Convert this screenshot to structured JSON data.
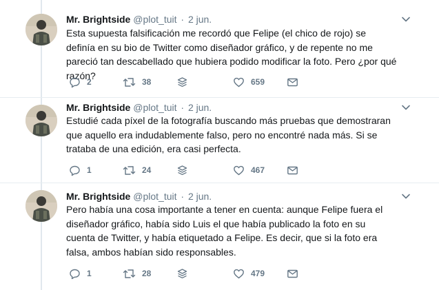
{
  "tweets": [
    {
      "author": "Mr. Brightside",
      "handle": "@plot_tuit",
      "separator": "·",
      "date": "2 jun.",
      "text": "Esta supuesta falsificación me recordó que Felipe (el chico de rojo) se definía en su bio de Twitter como diseñador gráfico, y de repente no me pareció tan descabellado que hubiera podido modificar la foto. Pero ¿por qué razón?",
      "replies": "2",
      "retweets": "38",
      "likes": "659"
    },
    {
      "author": "Mr. Brightside",
      "handle": "@plot_tuit",
      "separator": "·",
      "date": "2 jun.",
      "text": "Estudié cada píxel de la fotografía buscando más pruebas que demostraran que aquello era indudablemente falso, pero no encontré nada más. Si se trataba de una edición, era casi perfecta.",
      "replies": "1",
      "retweets": "24",
      "likes": "467"
    },
    {
      "author": "Mr. Brightside",
      "handle": "@plot_tuit",
      "separator": "·",
      "date": "2 jun.",
      "text": "Pero había una cosa importante a tener en cuenta: aunque Felipe fuera el diseñador gráfico, había sido Luis el que había publicado la foto en su cuenta de Twitter, y había etiquetado a Felipe. Es decir, que si la foto era falsa, ambos habían sido responsables.",
      "replies": "1",
      "retweets": "28",
      "likes": "479"
    }
  ],
  "icons": {
    "reply": "reply-icon",
    "retweet": "retweet-icon",
    "stack": "stack-icon",
    "like": "heart-icon",
    "dm": "envelope-icon",
    "menu": "chevron-down-icon"
  },
  "colors": {
    "text": "#14171a",
    "secondary": "#657786",
    "divider": "#e6ecf0",
    "thread": "#e1e8ed"
  }
}
